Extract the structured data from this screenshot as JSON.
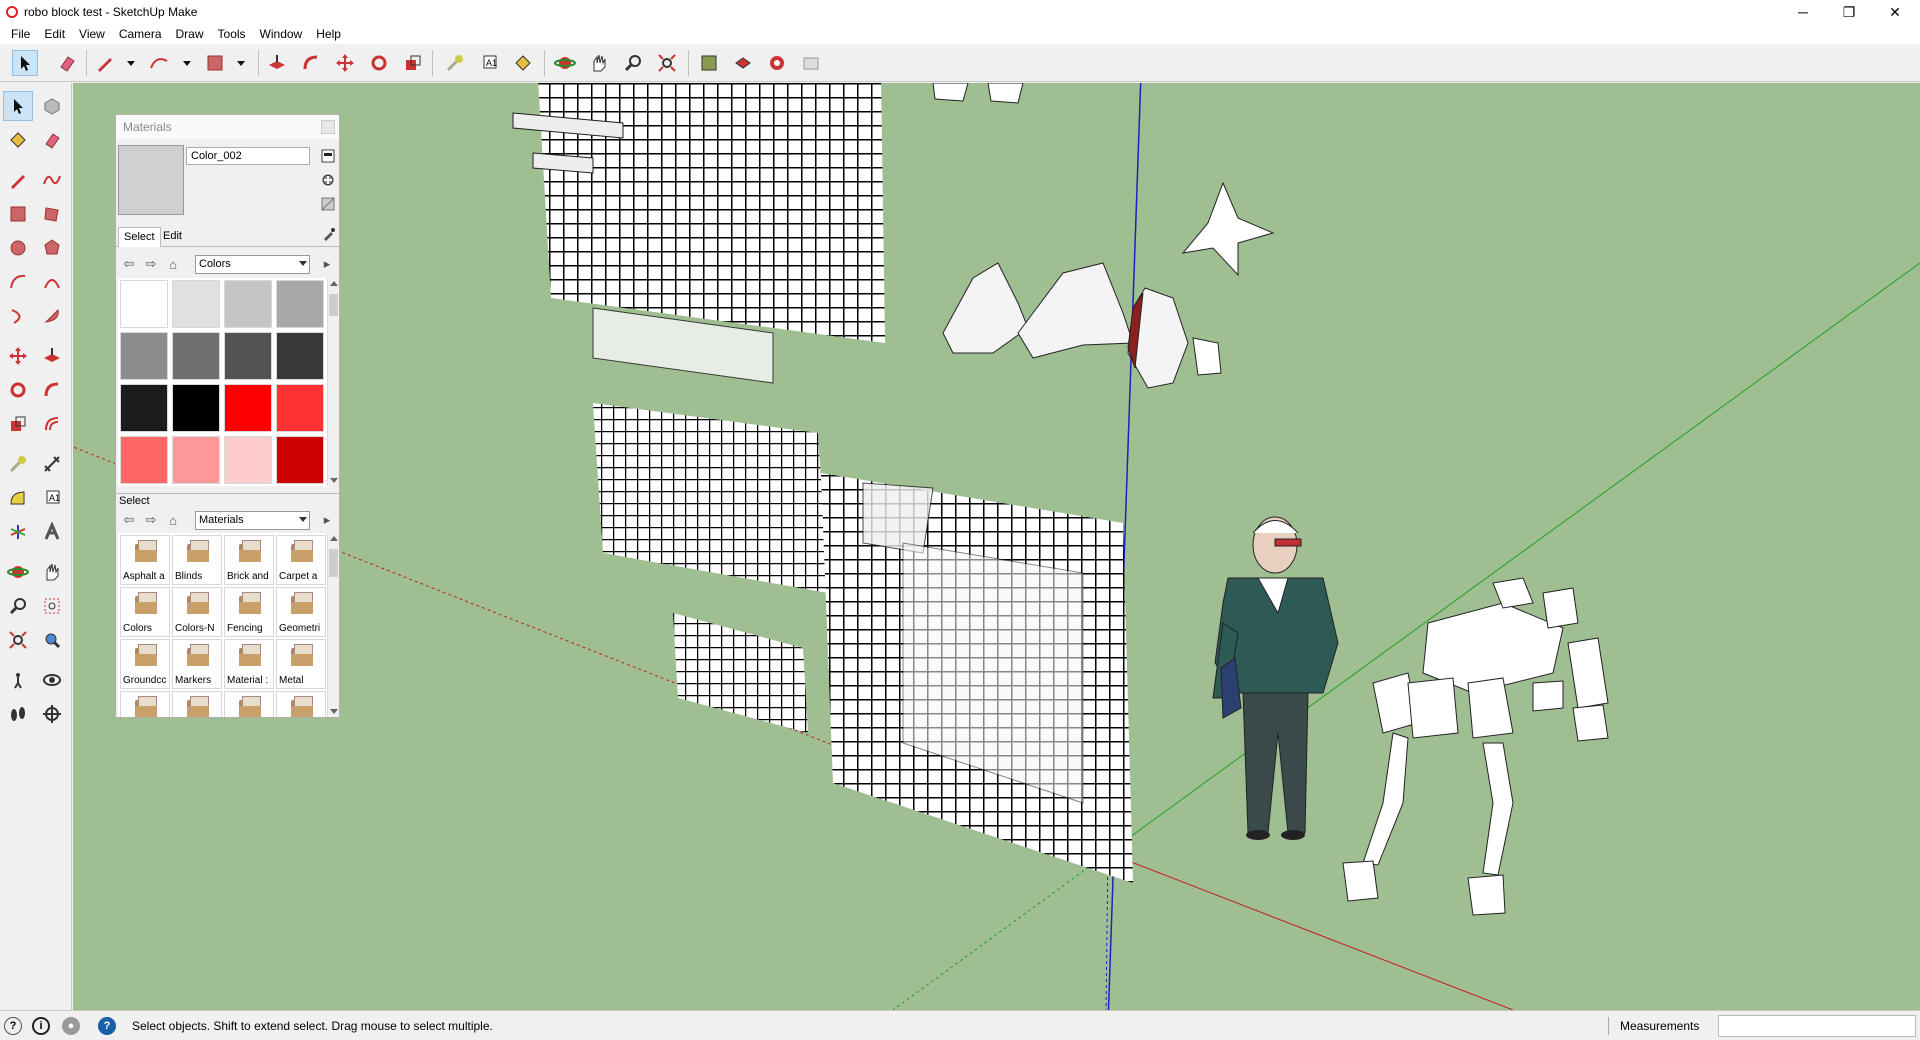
{
  "window": {
    "title": "robo block test - SketchUp Make"
  },
  "window_controls": {
    "minimize": "─",
    "maximize": "❐",
    "close": "✕"
  },
  "menu": [
    "File",
    "Edit",
    "View",
    "Camera",
    "Draw",
    "Tools",
    "Window",
    "Help"
  ],
  "materials_panel": {
    "title": "Materials",
    "material_name": "Color_002",
    "tabs": [
      "Select",
      "Edit"
    ],
    "colors_dropdown": "Colors",
    "swatches": [
      "#ffffff",
      "#e0e0e0",
      "#c4c4c4",
      "#a8a8a8",
      "#8c8c8c",
      "#707070",
      "#545454",
      "#383838",
      "#1c1c1c",
      "#000000",
      "#ff0000",
      "#ff3333",
      "#ff6666",
      "#ff9999",
      "#ffcccc",
      "#cc0000"
    ],
    "library_section_label": "Select",
    "library_dropdown": "Materials",
    "library_items": [
      "Asphalt a",
      "Blinds",
      "Brick and",
      "Carpet a",
      "Colors",
      "Colors-N",
      "Fencing",
      "Geometri",
      "Groundcc",
      "Markers",
      "Material :",
      "Metal",
      "",
      "",
      "",
      ""
    ]
  },
  "status": {
    "message": "Select objects. Shift to extend select. Drag mouse to select multiple.",
    "measurements_label": "Measurements",
    "measurements_value": ""
  },
  "colors": {
    "viewport_bg": "#9fbf93",
    "accent_active": "#cce4f7"
  }
}
